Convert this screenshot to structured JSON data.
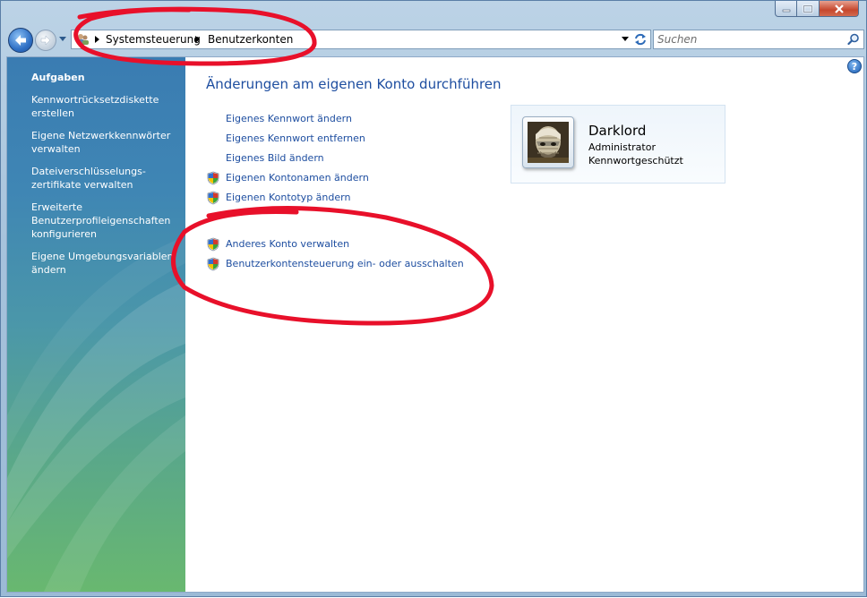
{
  "window": {
    "caption_buttons": [
      "minimize",
      "maximize",
      "close"
    ]
  },
  "navigation": {
    "breadcrumbs": [
      "Systemsteuerung",
      "Benutzerkonten"
    ],
    "search_placeholder": "Suchen"
  },
  "sidebar": {
    "heading": "Aufgaben",
    "items": [
      {
        "label": "Kennwortrücksetzdiskette erstellen"
      },
      {
        "label": "Eigene Netzwerkkennwörter verwalten"
      },
      {
        "label": "Dateiverschlüsselungs-zertifikate verwalten"
      },
      {
        "label": "Erweiterte Benutzerprofileigenschaften konfigurieren"
      },
      {
        "label": "Eigene Umgebungsvariablen ändern"
      }
    ]
  },
  "main": {
    "title": "Änderungen am eigenen Konto durchführen",
    "tasks_group1": [
      {
        "label": "Eigenes Kennwort ändern",
        "shield": false
      },
      {
        "label": "Eigenes Kennwort entfernen",
        "shield": false
      },
      {
        "label": "Eigenes Bild ändern",
        "shield": false
      },
      {
        "label": "Eigenen Kontonamen ändern",
        "shield": true
      },
      {
        "label": "Eigenen Kontotyp ändern",
        "shield": true
      }
    ],
    "tasks_group2": [
      {
        "label": "Anderes Konto verwalten",
        "shield": true
      },
      {
        "label": "Benutzerkontensteuerung ein- oder ausschalten",
        "shield": true
      }
    ]
  },
  "account": {
    "name": "Darklord",
    "type": "Administrator",
    "status": "Kennwortgeschützt"
  },
  "colors": {
    "link": "#1e4ea0",
    "annotation": "#e8102a"
  }
}
